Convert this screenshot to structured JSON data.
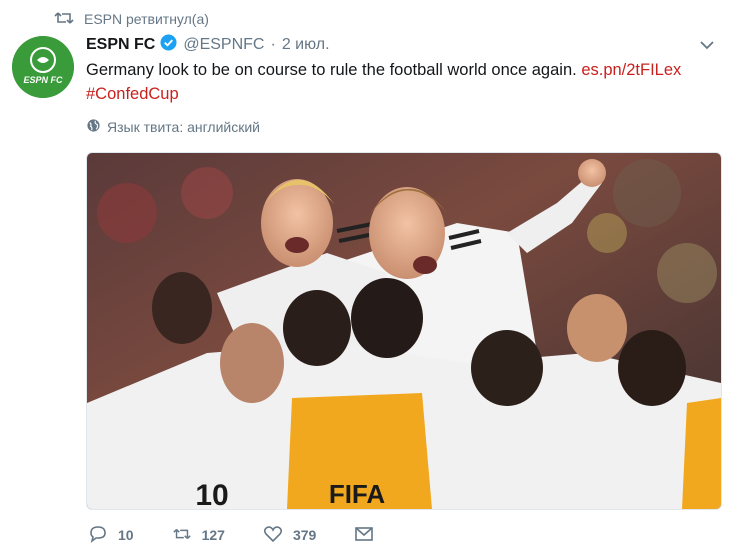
{
  "retweet": {
    "label": "ESPN ретвитнул(а)"
  },
  "tweet": {
    "name": "ESPN FC",
    "handle": "@ESPNFC",
    "separator": "·",
    "time": "2 июл.",
    "text_part1": "Germany look to be on course to rule the football world once again.",
    "link": "es.pn/2tFILex",
    "hashtag": "#ConfedCup",
    "language_label": "Язык твита: английский",
    "avatar_text": "ESPN FC"
  },
  "photo": {
    "shirt_text": "FIFA",
    "jersey_number": "10"
  },
  "actions": {
    "replies": "10",
    "retweets": "127",
    "likes": "379"
  },
  "colors": {
    "link": "#c9211e",
    "secondary_text": "#657786",
    "verified": "#1da1f2",
    "avatar_bg": "#3a9b3a"
  },
  "icons": [
    "retweet-icon",
    "verified-icon",
    "chevron-down-icon",
    "globe-icon",
    "reply-icon",
    "like-icon",
    "message-icon"
  ]
}
